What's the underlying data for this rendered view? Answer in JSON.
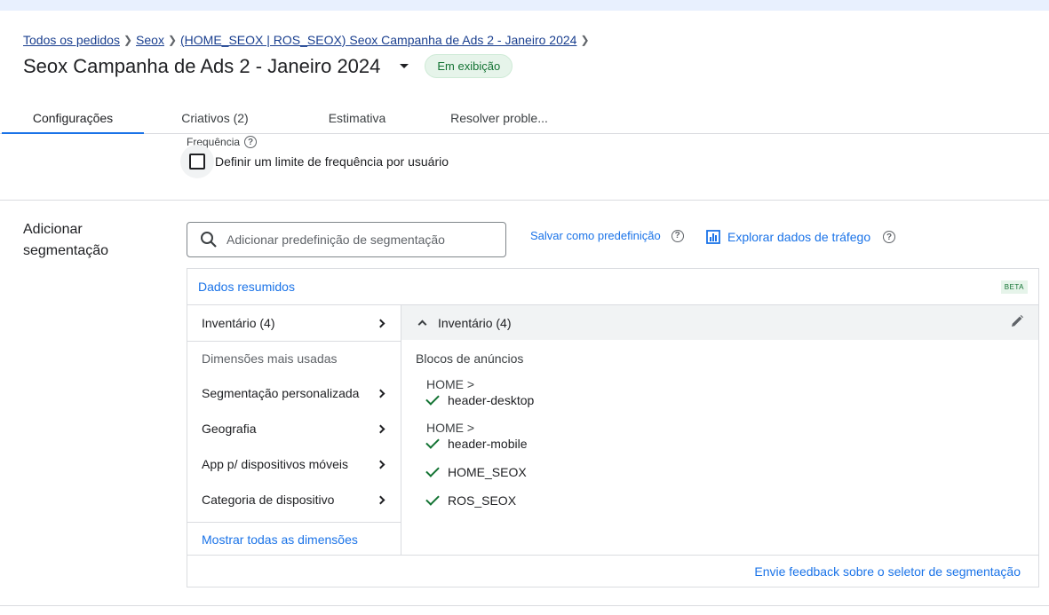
{
  "breadcrumb": {
    "items": [
      "Todos os pedidos",
      "Seox",
      "(HOME_SEOX | ROS_SEOX) Seox Campanha de Ads 2 - Janeiro 2024"
    ]
  },
  "header": {
    "title": "Seox Campanha de Ads 2 - Janeiro 2024",
    "status": "Em exibição",
    "status_color": "#137333"
  },
  "tabs": [
    {
      "label": "Configurações",
      "active": true
    },
    {
      "label": "Criativos (2)",
      "active": false
    },
    {
      "label": "Estimativa",
      "active": false
    },
    {
      "label": "Resolver proble...",
      "active": false
    }
  ],
  "frequency": {
    "label": "Frequência",
    "checkbox_label": "Definir um limite de frequência por usuário",
    "checked": false
  },
  "targeting": {
    "section_label": "Adicionar segmentação",
    "search_placeholder": "Adicionar predefinição de segmentação",
    "save_preset": "Salvar como predefinição",
    "explore_traffic": "Explorar dados de tráfego",
    "summary_title": "Dados resumidos",
    "beta": "BETA",
    "left_menu": {
      "inventory": "Inventário (4)",
      "most_used_heading": "Dimensões mais usadas",
      "items": [
        "Segmentação personalizada",
        "Geografia",
        "App p/ dispositivos móveis",
        "Categoria de dispositivo"
      ],
      "show_all": "Mostrar todas as dimensões"
    },
    "inventory_panel": {
      "header": "Inventário (4)",
      "blocks_title": "Blocos de anúncios",
      "items": [
        {
          "path": "HOME >",
          "name": "header-desktop"
        },
        {
          "path": "HOME >",
          "name": "header-mobile"
        },
        {
          "path": "",
          "name": "HOME_SEOX"
        },
        {
          "path": "",
          "name": "ROS_SEOX"
        }
      ]
    },
    "feedback": "Envie feedback sobre o seletor de segmentação",
    "accent_color": "#1a73e8"
  }
}
